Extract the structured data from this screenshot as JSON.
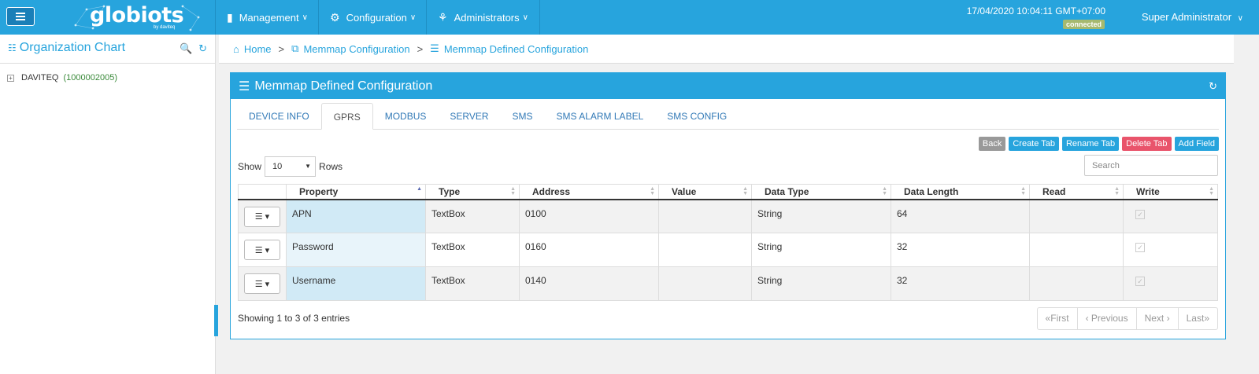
{
  "header": {
    "logo_text": "globiots",
    "logo_sub": "by daviteq",
    "nav": [
      {
        "label": "Management",
        "icon": "mobile-icon"
      },
      {
        "label": "Configuration",
        "icon": "cogs-icon"
      },
      {
        "label": "Administrators",
        "icon": "sitemap-icon"
      }
    ],
    "datetime": "17/04/2020 10:04:11 GMT+07:00",
    "status": "connected",
    "user": "Super Administrator"
  },
  "sidebar": {
    "title": "Organization Chart",
    "tree": [
      {
        "name": "DAVITEQ",
        "code": "(1000002005)"
      }
    ]
  },
  "breadcrumb": {
    "home": "Home",
    "level1": "Memmap Configuration",
    "level2": "Memmap Defined Configuration"
  },
  "panel": {
    "title": "Memmap Defined Configuration",
    "tabs": [
      "DEVICE INFO",
      "GPRS",
      "MODBUS",
      "SERVER",
      "SMS",
      "SMS ALARM LABEL",
      "SMS CONFIG"
    ],
    "active_tab": "GPRS",
    "actions": {
      "back": "Back",
      "create_tab": "Create Tab",
      "rename_tab": "Rename Tab",
      "delete_tab": "Delete Tab",
      "add_field": "Add Field"
    },
    "show_label": "Show",
    "rows_value": "10",
    "rows_label": "Rows",
    "search_placeholder": "Search",
    "columns": [
      "Property",
      "Type",
      "Address",
      "Value",
      "Data Type",
      "Data Length",
      "Read",
      "Write"
    ],
    "rows": [
      {
        "property": "APN",
        "type": "TextBox",
        "address": "0100",
        "value": "",
        "data_type": "String",
        "data_length": "64",
        "read": "",
        "write": true
      },
      {
        "property": "Password",
        "type": "TextBox",
        "address": "0160",
        "value": "",
        "data_type": "String",
        "data_length": "32",
        "read": "",
        "write": true
      },
      {
        "property": "Username",
        "type": "TextBox",
        "address": "0140",
        "value": "",
        "data_type": "String",
        "data_length": "32",
        "read": "",
        "write": true
      }
    ],
    "info": "Showing 1 to 3 of 3 entries",
    "pager": {
      "first": "First",
      "previous": "Previous",
      "next": "Next",
      "last": "Last"
    }
  },
  "colors": {
    "brand": "#27a4dd",
    "danger": "#e9546b",
    "muted": "#999999",
    "status": "#a6b96f"
  }
}
